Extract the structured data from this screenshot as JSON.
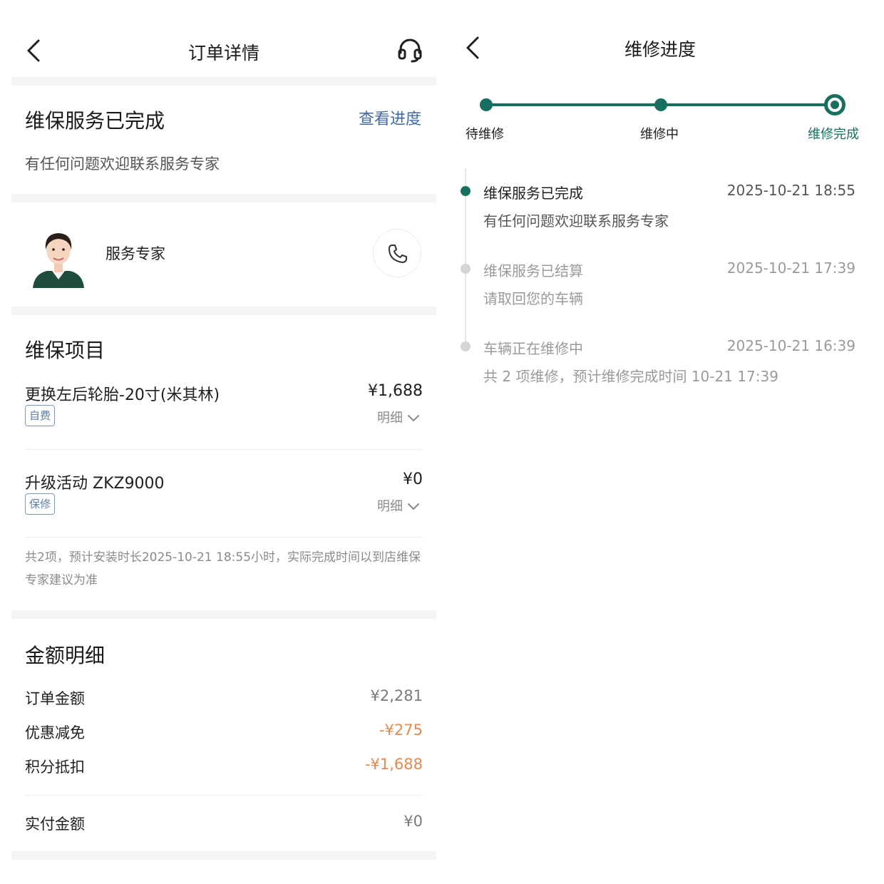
{
  "left": {
    "nav": {
      "title": "订单详情",
      "back_icon": "chevron-left-icon",
      "service_icon": "headset-icon"
    },
    "status": {
      "title": "维保服务已完成",
      "link": "查看进度",
      "subtitle": "有任何问题欢迎联系服务专家"
    },
    "expert": {
      "name": "服务专家",
      "phone_icon": "phone-icon"
    },
    "items_section": {
      "title": "维保项目",
      "items": [
        {
          "name": "更换左后轮胎-20寸(米其林)",
          "price": "¥1,688",
          "tag": "自费",
          "detail": "明细"
        },
        {
          "name": "升级活动 ZKZ9000",
          "price": "¥0",
          "tag": "保修",
          "detail": "明细"
        }
      ],
      "note": "共2项，预计安装时长2025-10-21 18:55小时，实际完成时间以到店维保专家建议为准"
    },
    "amount_section": {
      "title": "金额明细",
      "rows": [
        {
          "label": "订单金额",
          "value": "¥2,281"
        },
        {
          "label": "优惠减免",
          "value": "-¥275"
        },
        {
          "label": "积分抵扣",
          "value": "-¥1,688"
        }
      ],
      "total": {
        "label": "实付金额",
        "value": "¥0"
      }
    }
  },
  "right": {
    "nav": {
      "title": "维修进度",
      "back_icon": "chevron-left-icon"
    },
    "steps": [
      {
        "label": "待维修",
        "state": "done"
      },
      {
        "label": "维修中",
        "state": "done"
      },
      {
        "label": "维修完成",
        "state": "current"
      }
    ],
    "timeline": [
      {
        "title": "维保服务已完成",
        "time": "2025-10-21 18:55",
        "subtitle": "有任何问题欢迎联系服务专家",
        "active": true
      },
      {
        "title": "维保服务已结算",
        "time": "2025-10-21 17:39",
        "subtitle": "请取回您的车辆",
        "active": false
      },
      {
        "title": "车辆正在维修中",
        "time": "2025-10-21 16:39",
        "subtitle": "共 2 项维修，预计维修完成时间 10-21 17:39",
        "active": false
      }
    ]
  },
  "colors": {
    "accent_green": "#17705f",
    "link_blue": "#3f6aa5",
    "discount_orange": "#e5894f",
    "tag_blue": "#5f7fae"
  }
}
